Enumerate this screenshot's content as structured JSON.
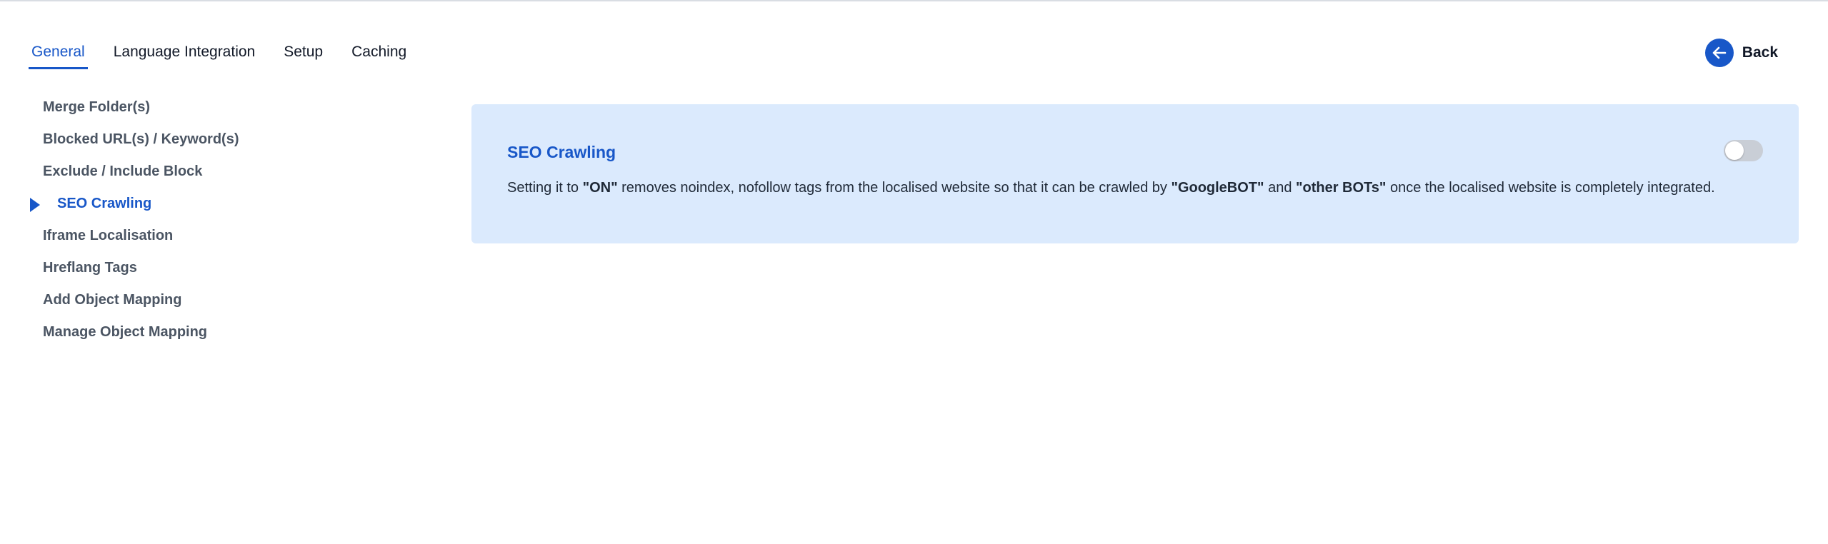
{
  "tabs": [
    {
      "label": "General",
      "active": true
    },
    {
      "label": "Language Integration",
      "active": false
    },
    {
      "label": "Setup",
      "active": false
    },
    {
      "label": "Caching",
      "active": false
    }
  ],
  "back": {
    "label": "Back",
    "icon": "arrow-left-icon"
  },
  "sidebar": {
    "items": [
      {
        "label": "Merge Folder(s)",
        "active": false
      },
      {
        "label": "Blocked URL(s) / Keyword(s)",
        "active": false
      },
      {
        "label": "Exclude / Include Block",
        "active": false
      },
      {
        "label": "SEO Crawling",
        "active": true
      },
      {
        "label": "Iframe Localisation",
        "active": false
      },
      {
        "label": "Hreflang Tags",
        "active": false
      },
      {
        "label": "Add Object Mapping",
        "active": false
      },
      {
        "label": "Manage Object Mapping",
        "active": false
      }
    ]
  },
  "panel": {
    "title": "SEO Crawling",
    "toggle_on": false,
    "description": {
      "part1": "Setting it to ",
      "on": "\"ON\"",
      "part2": " removes noindex, nofollow tags from the localised website so that it can be crawled by ",
      "googlebot": "\"GoogleBOT\"",
      "part3": " and ",
      "otherbots": "\"other BOTs\"",
      "part4": " once the localised website is completely integrated."
    }
  },
  "colors": {
    "accent": "#1857c8",
    "panel_bg": "#dbeafd",
    "toggle_off": "#c9ced6"
  }
}
